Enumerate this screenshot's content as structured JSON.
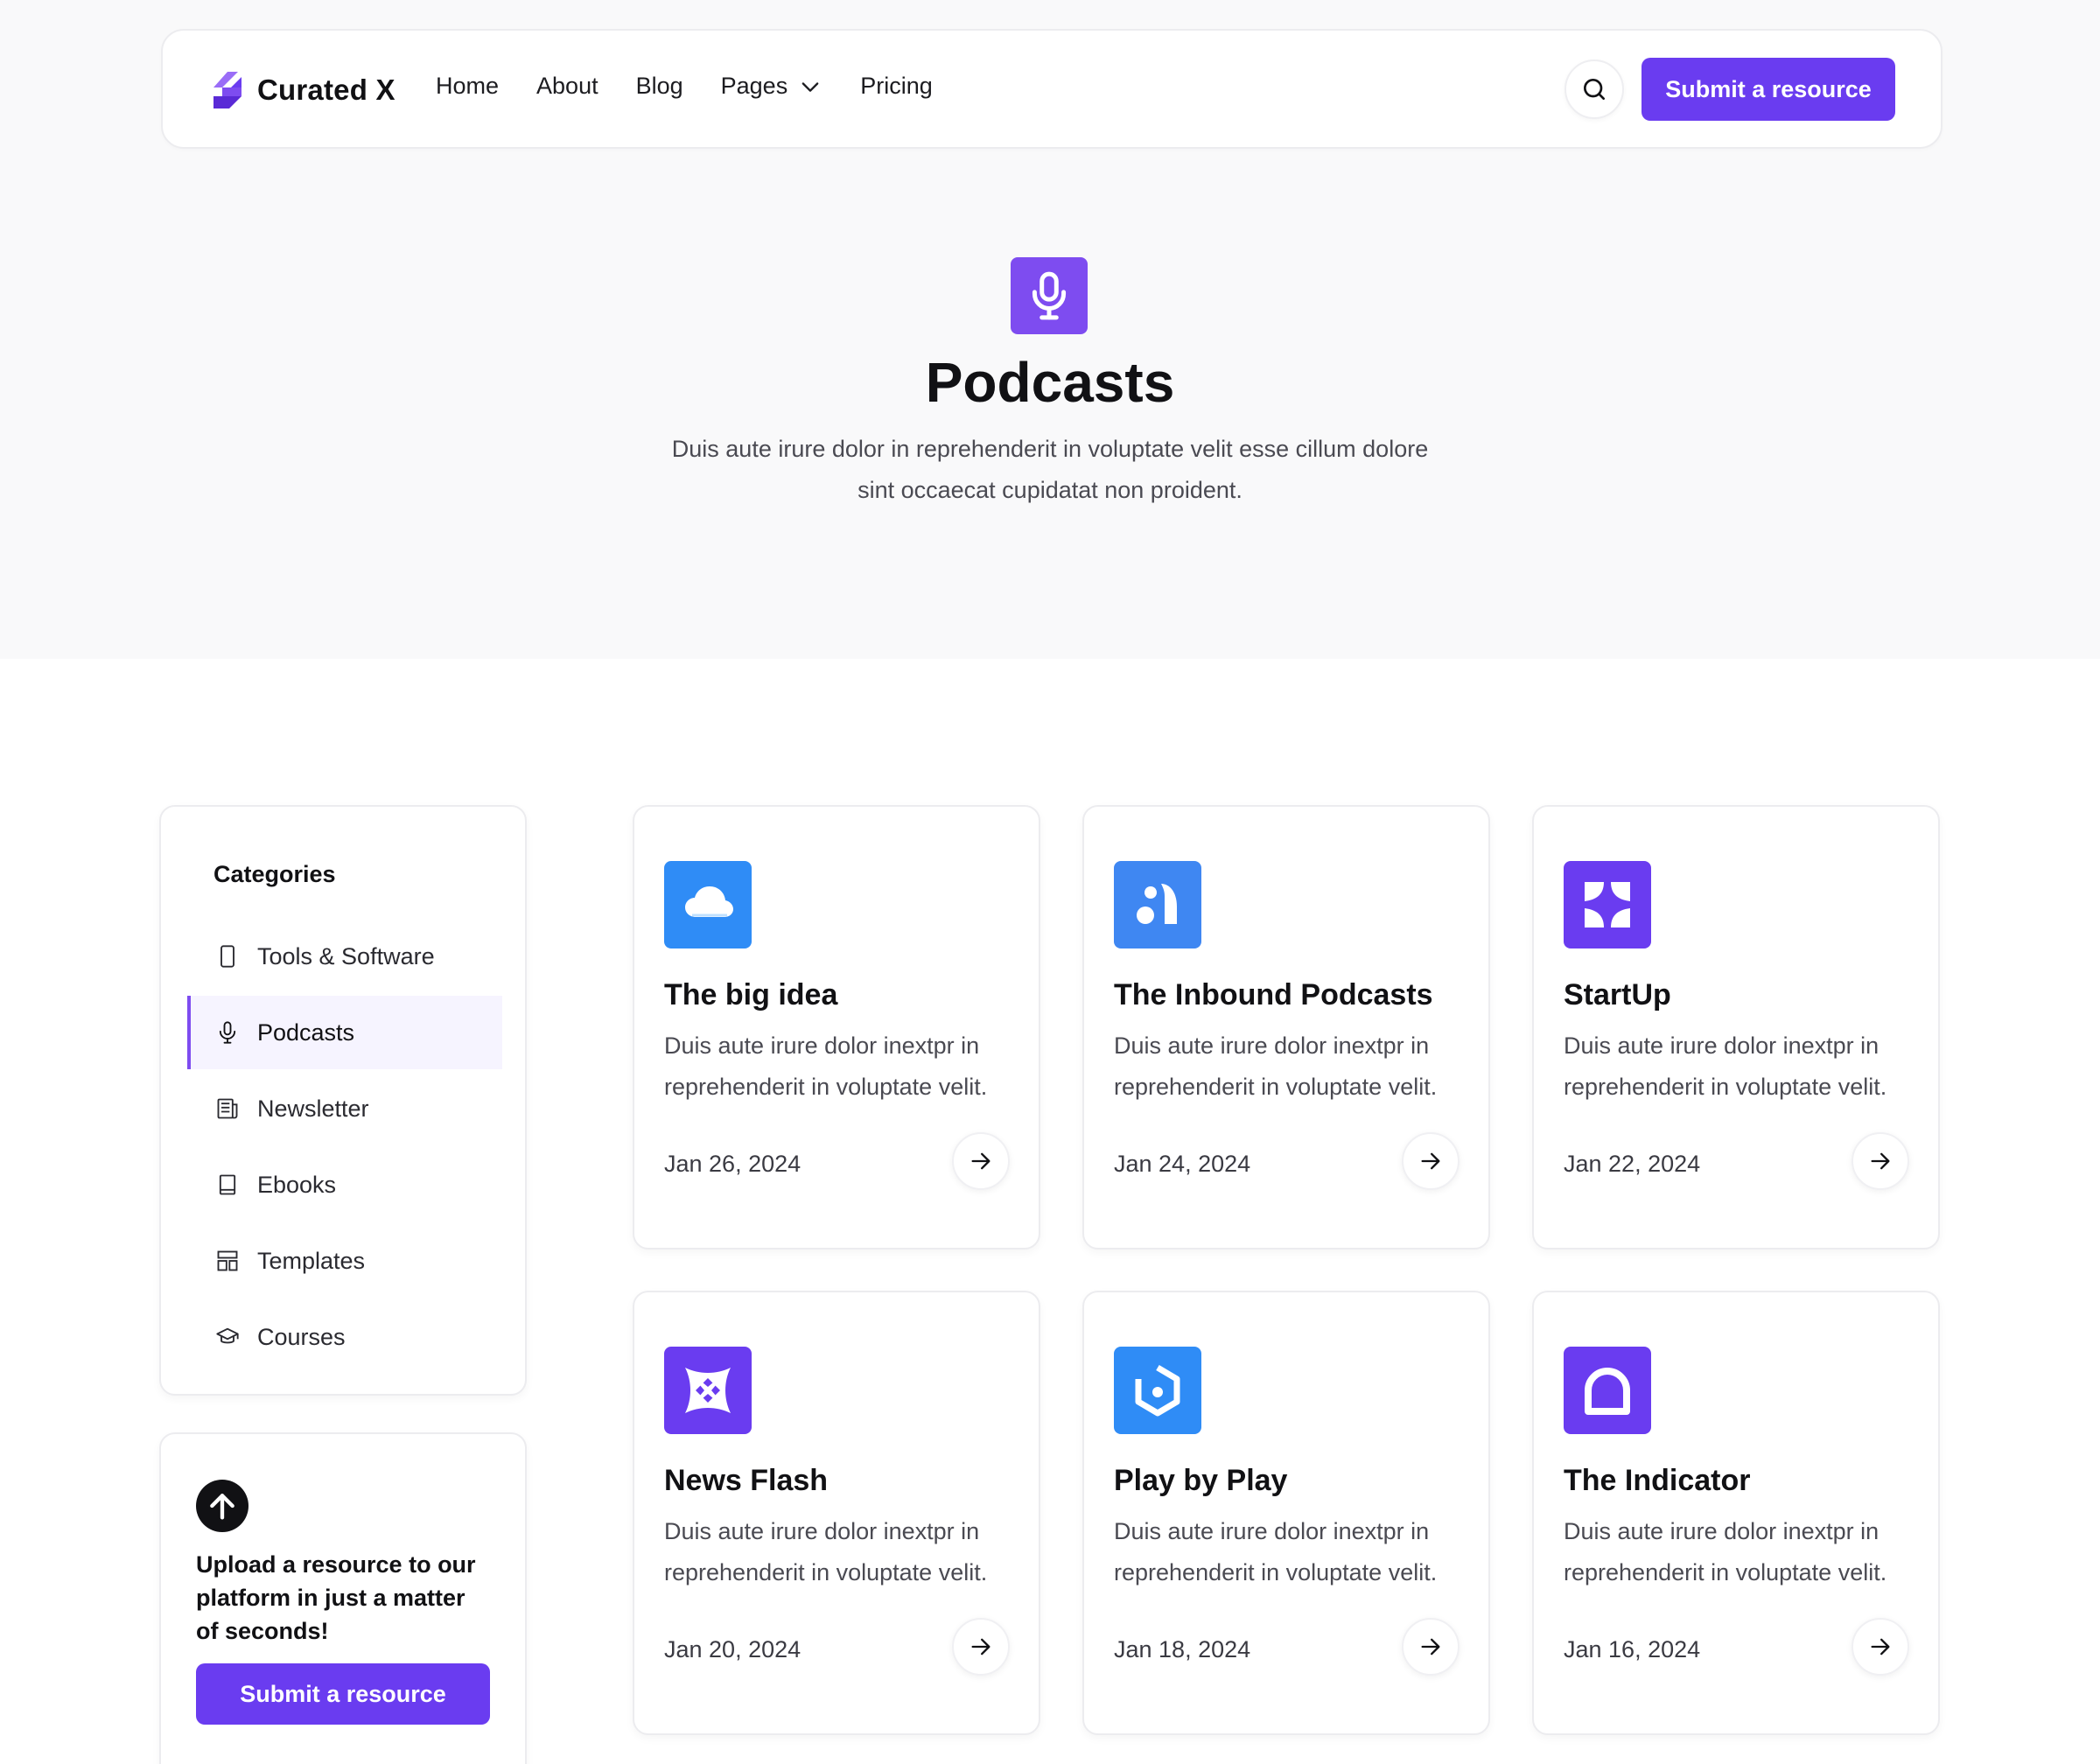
{
  "brand": {
    "name": "Curated X",
    "accent": "#6a3cf0"
  },
  "nav": {
    "items": [
      {
        "label": "Home"
      },
      {
        "label": "About"
      },
      {
        "label": "Blog"
      },
      {
        "label": "Pages",
        "has_dropdown": true
      },
      {
        "label": "Pricing"
      }
    ],
    "search_icon": "search-icon",
    "submit_label": "Submit a resource"
  },
  "hero": {
    "icon": "microphone-icon",
    "title": "Podcasts",
    "subtitle": "Duis aute irure dolor in reprehenderit in voluptate velit esse cillum dolore sint occaecat cupidatat non proident."
  },
  "sidebar": {
    "title": "Categories",
    "items": [
      {
        "label": "Tools & Software",
        "icon": "phone-icon",
        "active": false
      },
      {
        "label": "Podcasts",
        "icon": "microphone-icon",
        "active": true
      },
      {
        "label": "Newsletter",
        "icon": "newspaper-icon",
        "active": false
      },
      {
        "label": "Ebooks",
        "icon": "book-icon",
        "active": false
      },
      {
        "label": "Templates",
        "icon": "template-icon",
        "active": false
      },
      {
        "label": "Courses",
        "icon": "graduation-cap-icon",
        "active": false
      }
    ],
    "upload": {
      "icon": "upload-arrow-icon",
      "text": "Upload a resource to our platform in just a matter of seconds!",
      "button_label": "Submit a resource"
    }
  },
  "resources": [
    {
      "title": "The big idea",
      "description": "Duis aute irure dolor inextpr in reprehenderit in voluptate velit.",
      "date": "Jan 26, 2024",
      "icon": "cloud-icon",
      "color": "#2f8cf6"
    },
    {
      "title": "The Inbound Podcasts",
      "description": "Duis aute irure dolor inextpr in reprehenderit in voluptate velit.",
      "date": "Jan 24, 2024",
      "icon": "shapes-icon",
      "color": "#3f87f2"
    },
    {
      "title": "StartUp",
      "description": "Duis aute irure dolor inextpr in reprehenderit in voluptate velit.",
      "date": "Jan 22, 2024",
      "icon": "petals-icon",
      "color": "#6a3cf0"
    },
    {
      "title": "News Flash",
      "description": "Duis aute irure dolor inextpr in reprehenderit in voluptate velit.",
      "date": "Jan 20, 2024",
      "icon": "star-x-icon",
      "color": "#6a3cf0"
    },
    {
      "title": "Play by Play",
      "description": "Duis aute irure dolor inextpr in reprehenderit in voluptate velit.",
      "date": "Jan 18, 2024",
      "icon": "hexagon-icon",
      "color": "#2f8cf6"
    },
    {
      "title": "The Indicator",
      "description": "Duis aute irure dolor inextpr in reprehenderit in voluptate velit.",
      "date": "Jan 16, 2024",
      "icon": "bubble-icon",
      "color": "#6a3cf0"
    }
  ]
}
